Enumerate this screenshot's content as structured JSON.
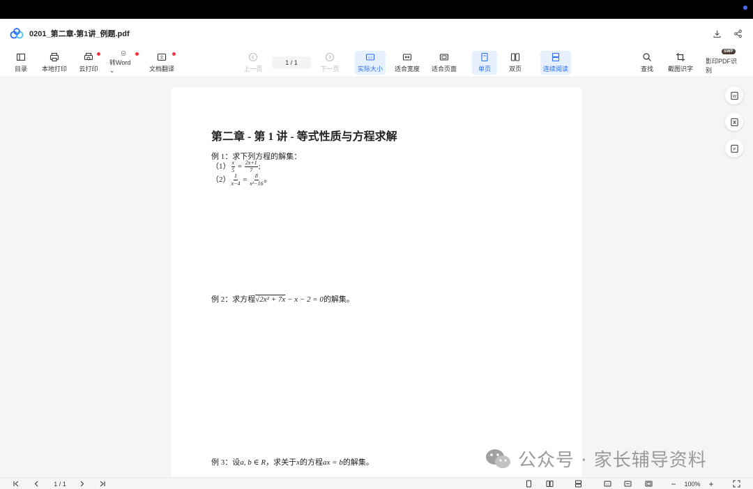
{
  "window": {
    "filename": "0201_第二章-第1讲_例题.pdf"
  },
  "toolbar": {
    "toc": "目录",
    "local_print": "本地打印",
    "cloud_print": "云打印",
    "to_word": "转Word",
    "translate": "文档翻译",
    "prev_page": "上一页",
    "page_indicator": "1 / 1",
    "next_page": "下一页",
    "actual_size": "实际大小",
    "fit_width": "适合宽度",
    "fit_page": "适合页面",
    "single_page": "单页",
    "double_page": "双页",
    "continuous": "连续阅读",
    "find": "查找",
    "screenshot_ocr": "截图识字",
    "scan_pdf": "影印PDF识别",
    "swp_badge": "SWP"
  },
  "document": {
    "title": "第二章 - 第 1 讲 - 等式性质与方程求解",
    "ex1_heading": "例 1：求下列方程的解集：",
    "ex1_item1_label": "（1）",
    "ex1_item2_label": "（2）",
    "ex2_text_pre": "例 2：求方程",
    "ex2_text_post": "的解集。",
    "ex3_text_pre": "例 3：设",
    "ex3_text_mid1": "，求关于",
    "ex3_text_mid2": "的方程",
    "ex3_text_post": "的解集。"
  },
  "bottom": {
    "page_indicator": "1 / 1",
    "zoom": "100%"
  },
  "watermark": "公众号 · 家长辅导资料",
  "colors": {
    "accent": "#2a6df4",
    "active_bg": "#e6f0ff",
    "badge_red": "#f5323c"
  }
}
